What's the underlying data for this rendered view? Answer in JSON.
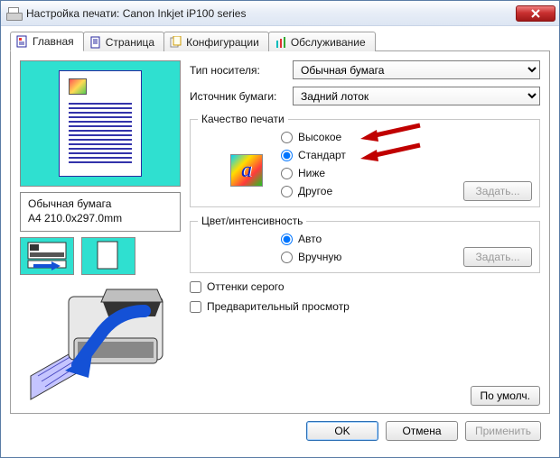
{
  "window": {
    "title": "Настройка печати: Canon Inkjet iP100 series"
  },
  "tabs": {
    "main": "Главная",
    "page": "Страница",
    "config": "Конфигурации",
    "service": "Обслуживание"
  },
  "media": {
    "type_label": "Тип носителя:",
    "type_value": "Обычная бумага",
    "source_label": "Источник бумаги:",
    "source_value": "Задний лоток"
  },
  "info": {
    "line1": "Обычная бумага",
    "line2": "A4 210.0x297.0mm"
  },
  "quality": {
    "legend": "Качество печати",
    "high": "Высокое",
    "standard": "Стандарт",
    "low": "Ниже",
    "other": "Другое",
    "set_btn": "Задать..."
  },
  "color": {
    "legend": "Цвет/интенсивность",
    "auto": "Авто",
    "manual": "Вручную",
    "set_btn": "Задать..."
  },
  "checks": {
    "grayscale": "Оттенки серого",
    "preview": "Предварительный просмотр"
  },
  "buttons": {
    "defaults": "По умолч.",
    "ok": "OK",
    "cancel": "Отмена",
    "apply": "Применить"
  }
}
